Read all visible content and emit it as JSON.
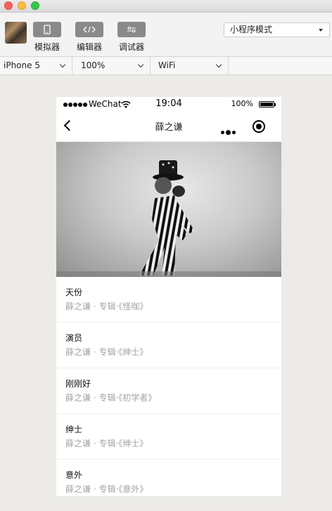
{
  "toolbar": {
    "tools": [
      {
        "label": "模拟器",
        "icon": "phone-icon"
      },
      {
        "label": "编辑器",
        "icon": "code-icon"
      },
      {
        "label": "调试器",
        "icon": "sliders-icon"
      }
    ],
    "mode_select": "小程序模式"
  },
  "devbar": {
    "device": "iPhone 5",
    "zoom": "100%",
    "network": "WiFi"
  },
  "phone": {
    "status": {
      "carrier": "WeChat",
      "time": "19:04",
      "battery": "100%"
    },
    "nav": {
      "title": "薛之谦"
    },
    "songs": [
      {
        "name": "天份",
        "meta": "薛之谦 · 专辑·《怪咖》"
      },
      {
        "name": "演员",
        "meta": "薛之谦 · 专辑·《绅士》"
      },
      {
        "name": "刚刚好",
        "meta": "薛之谦 · 专辑·《初学者》"
      },
      {
        "name": "绅士",
        "meta": "薛之谦 · 专辑·《绅士》"
      },
      {
        "name": "意外",
        "meta": "薛之谦 · 专辑·《意外》"
      }
    ]
  }
}
